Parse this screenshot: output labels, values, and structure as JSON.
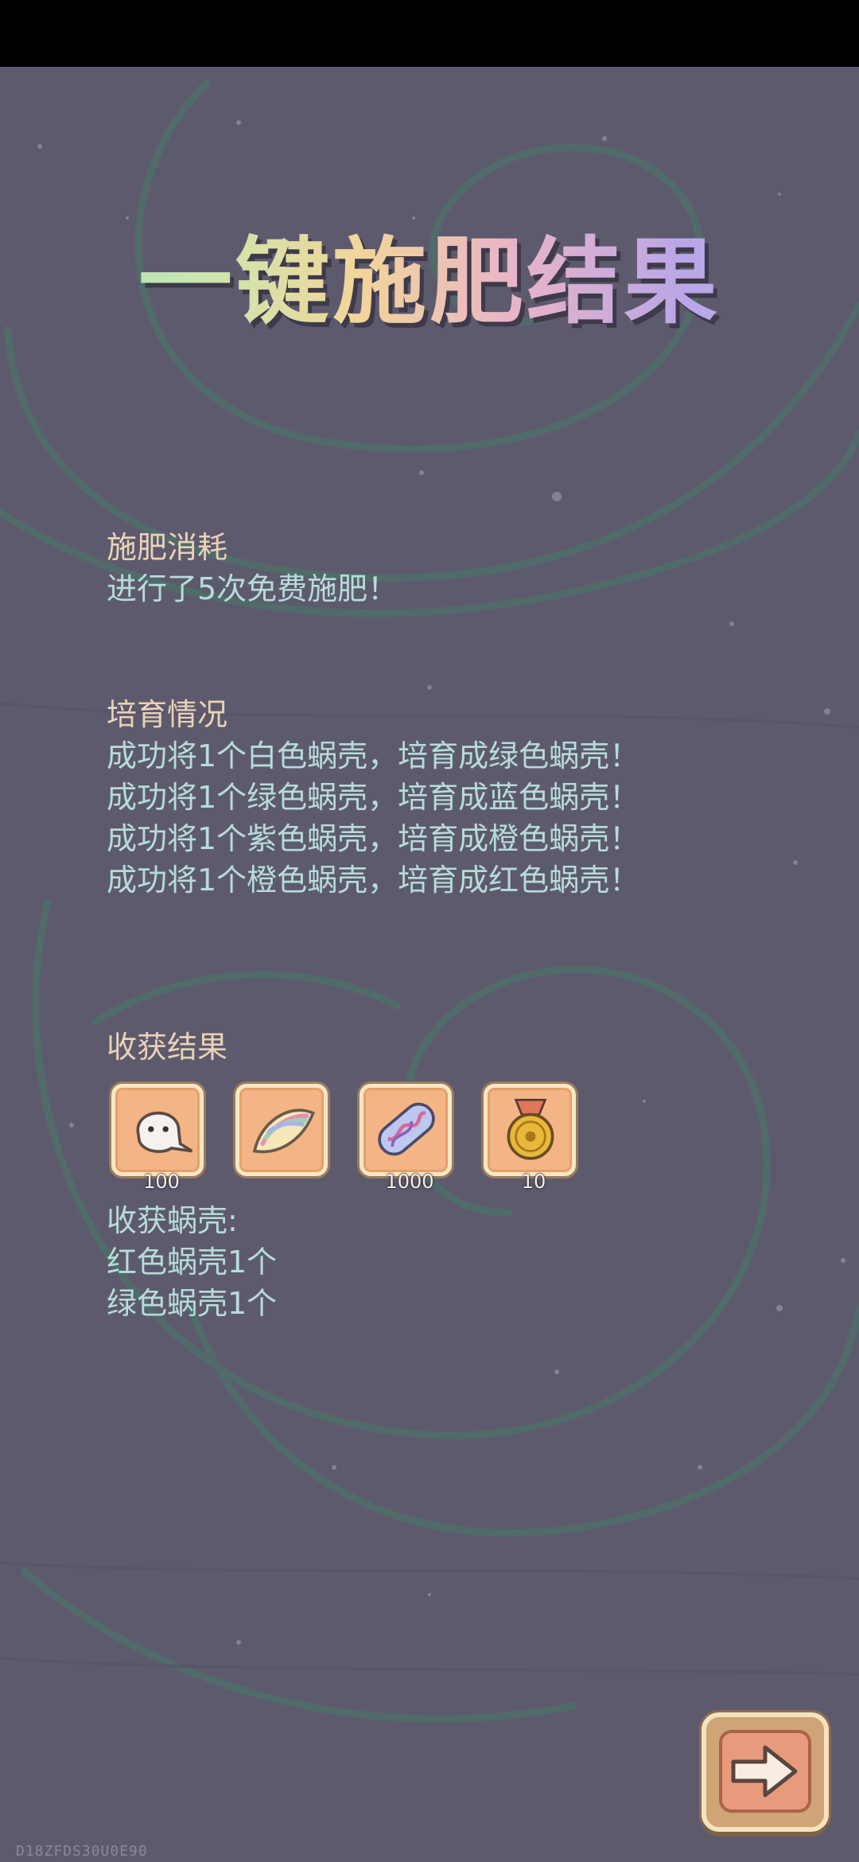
{
  "title": "一键施肥结果",
  "fertilize_cost": {
    "heading": "施肥消耗",
    "lines": [
      "进行了5次免费施肥！"
    ]
  },
  "cultivation": {
    "heading": "培育情况",
    "lines": [
      "成功将1个白色蜗壳，培育成绿色蜗壳！",
      "成功将1个绿色蜗壳，培育成蓝色蜗壳！",
      "成功将1个紫色蜗壳，培育成橙色蜗壳！",
      "成功将1个橙色蜗壳，培育成红色蜗壳！"
    ]
  },
  "harvest": {
    "heading": "收获结果",
    "items": [
      {
        "icon": "ghost-icon",
        "count": "100"
      },
      {
        "icon": "rainbow-shell-icon",
        "count": ""
      },
      {
        "icon": "pill-capsule-icon",
        "count": "1000"
      },
      {
        "icon": "gold-medal-icon",
        "count": "10"
      }
    ]
  },
  "shells": {
    "heading": "收获蜗壳:",
    "lines": [
      "红色蜗壳1个",
      "绿色蜗壳1个"
    ]
  },
  "next_button": {
    "icon": "arrow-right-icon"
  },
  "watermark": "D18ZFDS30U0E90",
  "colors": {
    "background": "#5e5a6e",
    "heading": "#e9d3b6",
    "body_text": "#b6dcd9",
    "item_tile": "#f3b585"
  }
}
